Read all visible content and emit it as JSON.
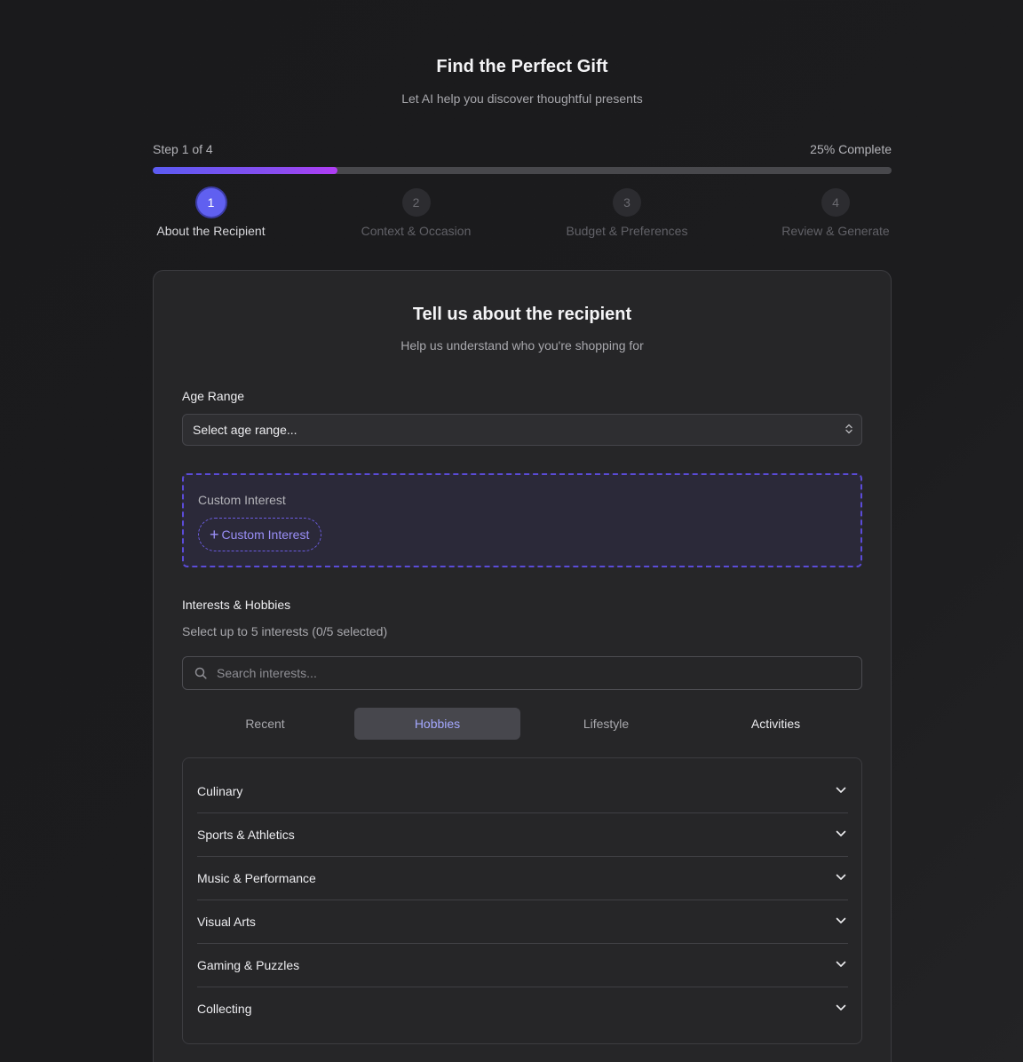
{
  "header": {
    "title": "Find the Perfect Gift",
    "subtitle": "Let AI help you discover thoughtful presents"
  },
  "progress": {
    "step_text": "Step 1 of 4",
    "percent_text": "25% Complete",
    "fraction": 0.25,
    "fill_color": "#6060f0"
  },
  "steps": [
    {
      "number": "1",
      "label": "About the Recipient",
      "active": true
    },
    {
      "number": "2",
      "label": "Context & Occasion",
      "active": false
    },
    {
      "number": "3",
      "label": "Budget & Preferences",
      "active": false
    },
    {
      "number": "4",
      "label": "Review & Generate",
      "active": false
    }
  ],
  "form": {
    "title": "Tell us about the recipient",
    "subtitle": "Help us understand who you're shopping for",
    "age_range": {
      "label": "Age Range",
      "selected": "Select age range..."
    },
    "custom_interest": {
      "label": "Custom Interest",
      "button_label": "Custom Interest",
      "button_icon": "plus-icon"
    },
    "interests": {
      "label": "Interests & Hobbies",
      "help": "Select up to 5 interests (0/5 selected)",
      "search_placeholder": "Search interests...",
      "search_value": ""
    },
    "tabs": [
      {
        "label": "Recent",
        "active": false
      },
      {
        "label": "Hobbies",
        "active": true
      },
      {
        "label": "Lifestyle",
        "active": false
      },
      {
        "label": "Activities",
        "active": false
      }
    ],
    "categories": [
      "Culinary",
      "Sports & Athletics",
      "Music & Performance",
      "Visual Arts",
      "Gaming & Puzzles",
      "Collecting"
    ]
  }
}
